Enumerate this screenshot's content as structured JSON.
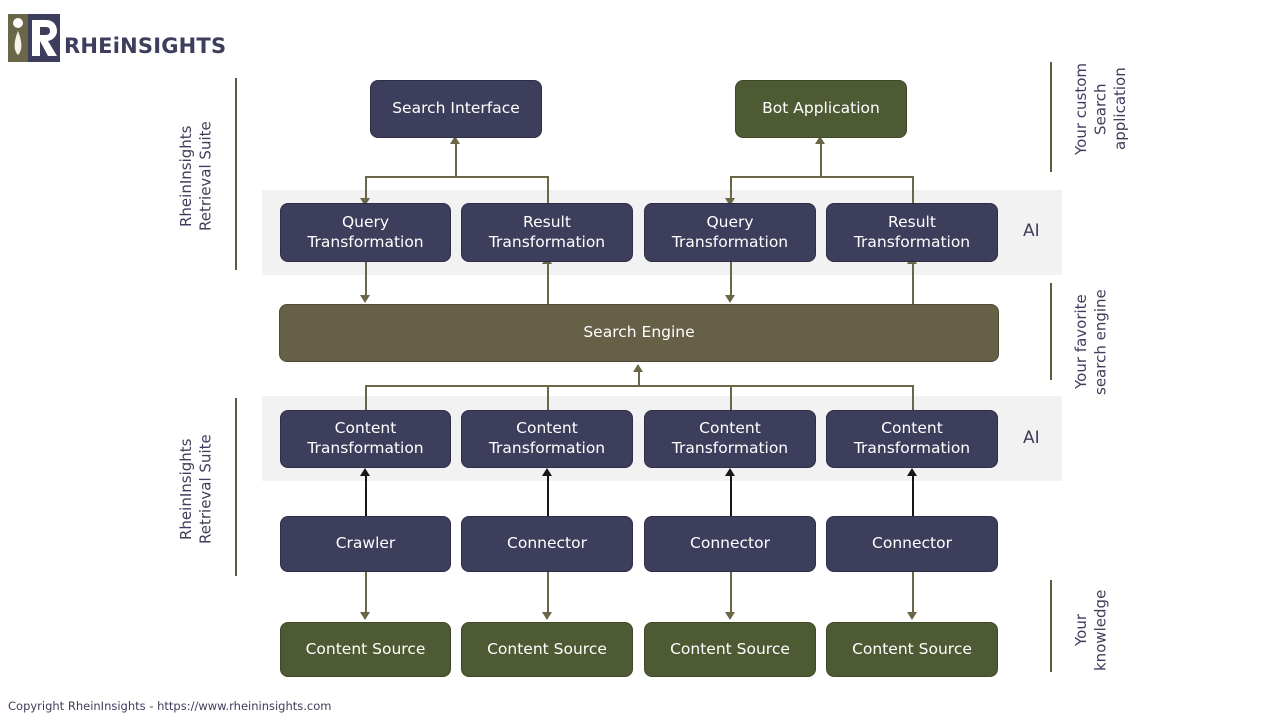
{
  "brand": {
    "wordmark": "RHEiNSIGHTS",
    "logo_icon": "rheininsights-logo-icon",
    "colors": {
      "navy": "#3d3d5c",
      "olive": "#4e5a33",
      "engine_olive": "#666047",
      "band_gray": "#f2f2f2",
      "connector_olive": "#6b6647",
      "connector_dark": "#17171b"
    }
  },
  "footer": {
    "copyright": "Copyright RheinInsights - https://www.rheininsights.com"
  },
  "left_labels": [
    {
      "text": "RheinInsights\nRetrieval Suite"
    },
    {
      "text": "RheinInsights\nRetrieval Suite"
    }
  ],
  "right_labels": [
    {
      "text": "Your custom\nSearch\napplication"
    },
    {
      "text": "Your favorite\nsearch engine"
    },
    {
      "text": "Your\nknowledge"
    }
  ],
  "ai_labels": [
    {
      "text": "AI"
    },
    {
      "text": "AI"
    }
  ],
  "rows": {
    "applications": [
      {
        "label": "Search Interface",
        "style": "navy"
      },
      {
        "label": "Bot Application",
        "style": "olive"
      }
    ],
    "query_result": [
      {
        "label": "Query\nTransformation",
        "style": "navy"
      },
      {
        "label": "Result\nTransformation",
        "style": "navy"
      },
      {
        "label": "Query\nTransformation",
        "style": "navy"
      },
      {
        "label": "Result\nTransformation",
        "style": "navy"
      }
    ],
    "engine": {
      "label": "Search Engine",
      "style": "engine"
    },
    "content_transformation": [
      {
        "label": "Content\nTransformation",
        "style": "navy"
      },
      {
        "label": "Content\nTransformation",
        "style": "navy"
      },
      {
        "label": "Content\nTransformation",
        "style": "navy"
      },
      {
        "label": "Content\nTransformation",
        "style": "navy"
      }
    ],
    "connectors": [
      {
        "label": "Crawler",
        "style": "navy"
      },
      {
        "label": "Connector",
        "style": "navy"
      },
      {
        "label": "Connector",
        "style": "navy"
      },
      {
        "label": "Connector",
        "style": "navy"
      }
    ],
    "sources": [
      {
        "label": "Content Source",
        "style": "olive"
      },
      {
        "label": "Content Source",
        "style": "olive"
      },
      {
        "label": "Content Source",
        "style": "olive"
      },
      {
        "label": "Content Source",
        "style": "olive"
      }
    ]
  }
}
